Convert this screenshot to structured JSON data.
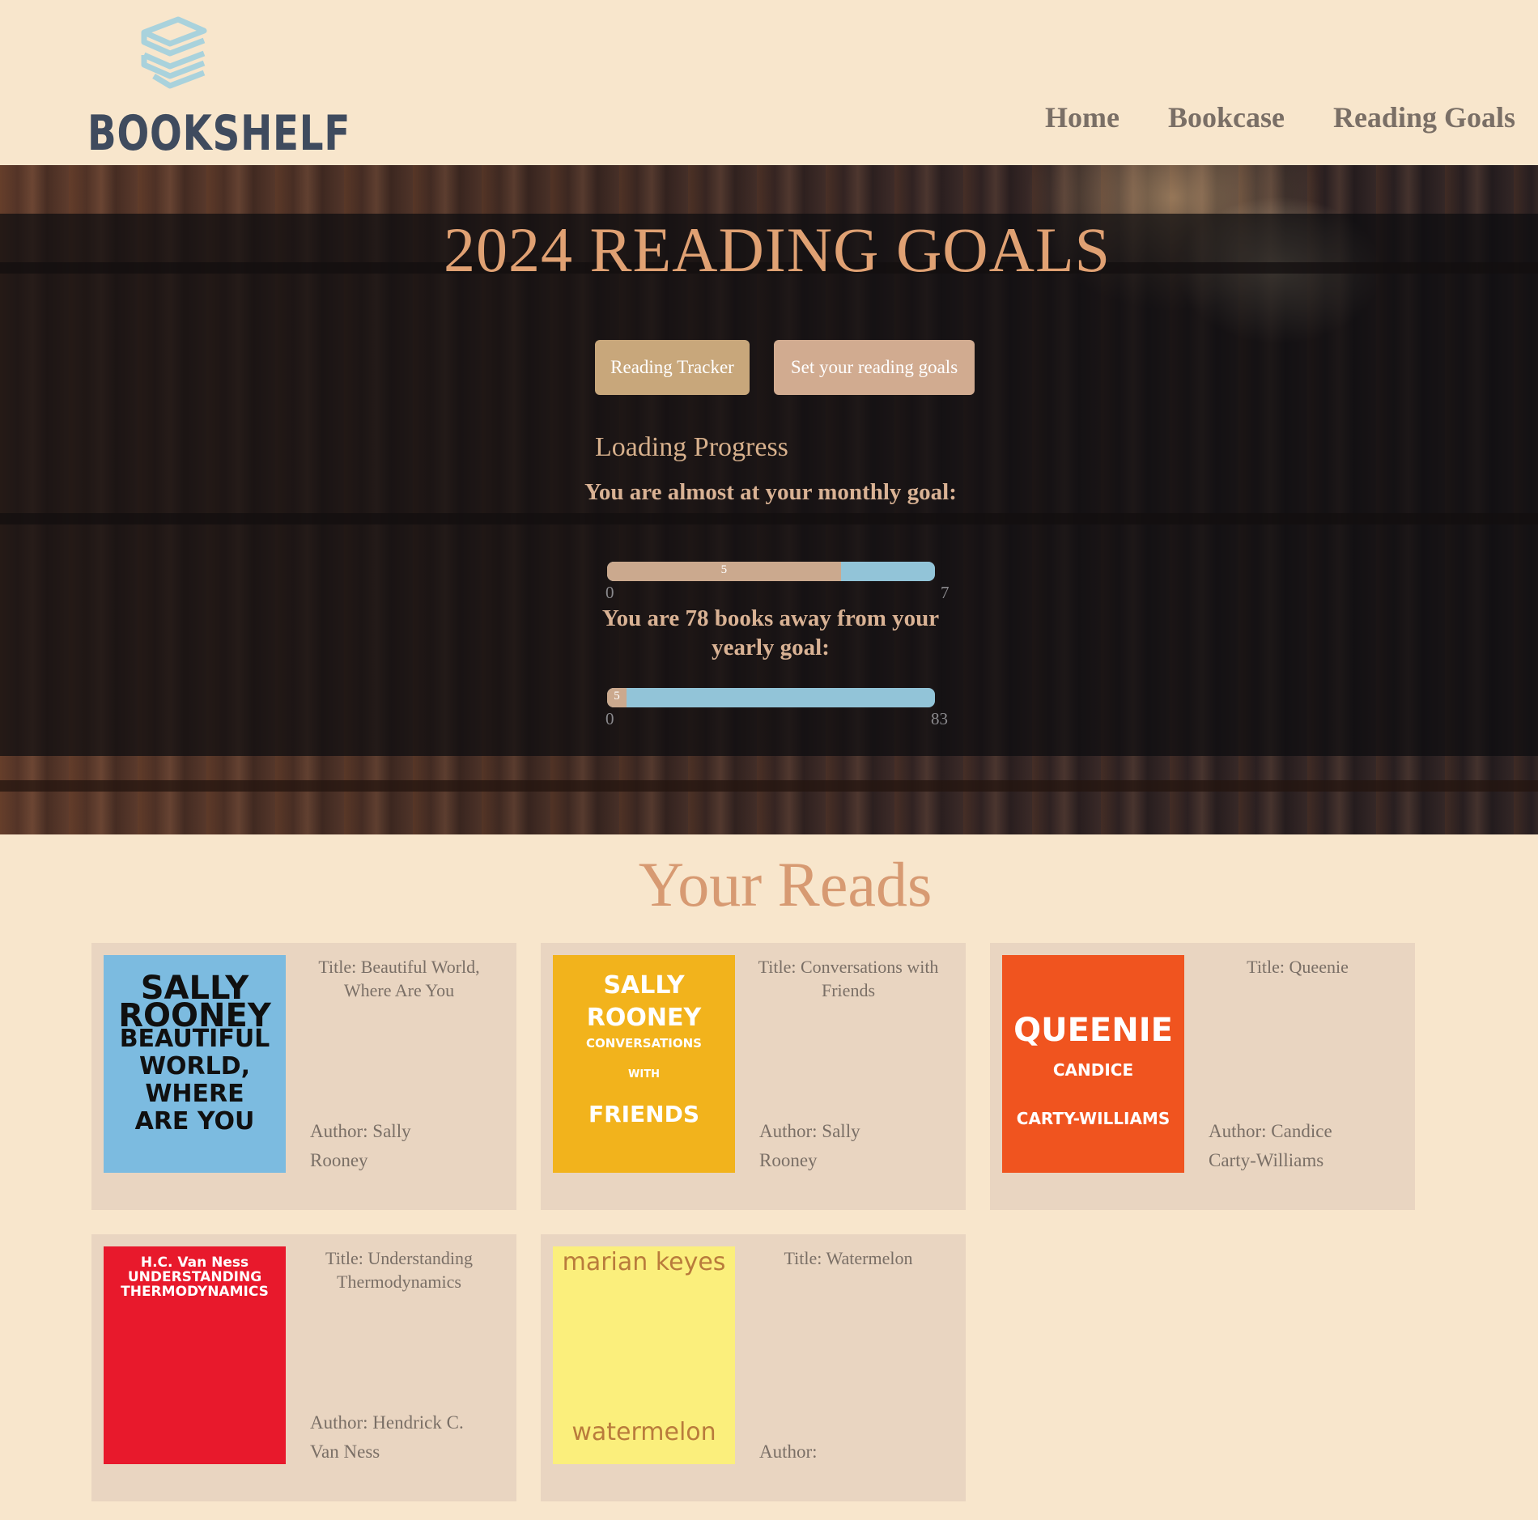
{
  "header": {
    "logo_text": "BOOKSHELF",
    "nav": [
      "Home",
      "Bookcase",
      "Reading Goals"
    ]
  },
  "hero": {
    "title": "2024 READING GOALS",
    "buttons": {
      "tracker": "Reading Tracker",
      "set_goals": "Set your reading goals"
    },
    "progress_heading": "Loading Progress",
    "monthly": {
      "text": "You are almost at your monthly goal:",
      "value": 5,
      "min": "0",
      "max": "7",
      "value_label": "5"
    },
    "yearly": {
      "text": "You are 78 books away from your yearly goal:",
      "value": 5,
      "min": "0",
      "max": "83",
      "value_label": "5"
    }
  },
  "reads": {
    "heading": "Your Reads",
    "books": [
      {
        "title": "Title: Beautiful World, Where Are You",
        "author": "Author: Sally Rooney",
        "cover": {
          "bg": "#7cbbe0",
          "lines": [
            "SALLY",
            "ROONEY",
            "BEAUTIFUL",
            "WORLD,",
            "WHERE",
            "ARE YOU"
          ]
        }
      },
      {
        "title": "Title: Conversations with Friends",
        "author": "Author: Sally Rooney",
        "cover": {
          "bg": "#f2b31c",
          "lines": [
            "SALLY",
            "ROONEY",
            "CONVERSATIONS",
            "WITH",
            "FRIENDS"
          ]
        }
      },
      {
        "title": "Title: Queenie",
        "author": "Author: Candice Carty-Williams",
        "cover": {
          "bg": "#f0541f",
          "lines": [
            "QUEENIE",
            "CANDICE",
            "CARTY-WILLIAMS"
          ]
        }
      },
      {
        "title": "Title: Understanding Thermodynamics",
        "author": "Author: Hendrick C. Van Ness",
        "cover": {
          "bg": "#e8192c",
          "lines": [
            "H.C. Van Ness",
            "UNDERSTANDING",
            "THERMODYNAMICS"
          ]
        }
      },
      {
        "title": "Title: Watermelon",
        "author": "Author:",
        "cover": {
          "bg": "#fbef7c",
          "lines": [
            "marian keyes",
            "watermelon"
          ]
        }
      }
    ]
  }
}
